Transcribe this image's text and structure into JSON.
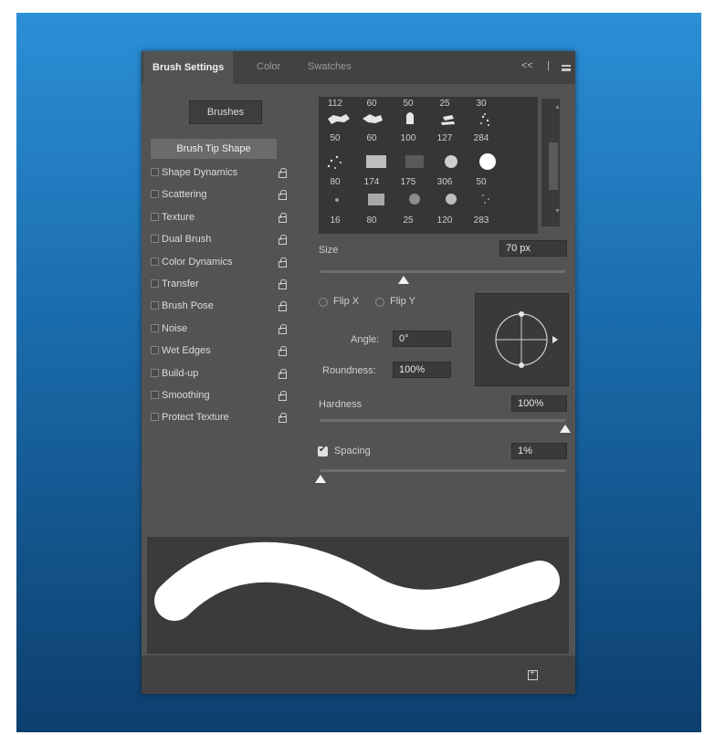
{
  "tabs": [
    {
      "label": "Brush Settings"
    },
    {
      "label": "Color"
    },
    {
      "label": "Swatches"
    }
  ],
  "tab_controls": {
    "collapse": "<<",
    "separator": "|"
  },
  "brushes_button": "Brushes",
  "brush_tip_shape": "Brush Tip Shape",
  "options": [
    {
      "label": "Shape Dynamics",
      "checked": false
    },
    {
      "label": "Scattering",
      "checked": false
    },
    {
      "label": "Texture",
      "checked": false
    },
    {
      "label": "Dual Brush",
      "checked": false
    },
    {
      "label": "Color Dynamics",
      "checked": false
    },
    {
      "label": "Transfer",
      "checked": false
    },
    {
      "label": "Brush Pose",
      "checked": false
    },
    {
      "label": "Noise",
      "checked": false
    },
    {
      "label": "Wet Edges",
      "checked": false
    },
    {
      "label": "Build-up",
      "checked": false
    },
    {
      "label": "Smoothing",
      "checked": false
    },
    {
      "label": "Protect Texture",
      "checked": false
    }
  ],
  "brush_grid": {
    "row0": [
      "112",
      "60",
      "50",
      "25",
      "30"
    ],
    "row1": [
      "50",
      "60",
      "100",
      "127",
      "284"
    ],
    "row2": [
      "80",
      "174",
      "175",
      "306",
      "50"
    ],
    "row3": [
      "16",
      "80",
      "25",
      "120",
      "283"
    ]
  },
  "size": {
    "label": "Size",
    "value": "70 px",
    "level": 0.34
  },
  "flip_x": "Flip X",
  "flip_y": "Flip Y",
  "angle": {
    "label": "Angle:",
    "value": "0°"
  },
  "roundness": {
    "label": "Roundness:",
    "value": "100%"
  },
  "hardness": {
    "label": "Hardness",
    "value": "100%",
    "level": 1.0
  },
  "spacing": {
    "label": "Spacing",
    "value": "1%",
    "checked": true,
    "level": 0.0
  },
  "colors": {
    "panel": "#535353",
    "tab_bar": "#424242",
    "background_top": "#2b8fd6",
    "background_bottom": "#0d3f6e",
    "stroke": "#ffffff"
  },
  "icons": [
    "collapse-icon",
    "panel-menu-icon",
    "lock-icon",
    "new-brush-icon"
  ]
}
